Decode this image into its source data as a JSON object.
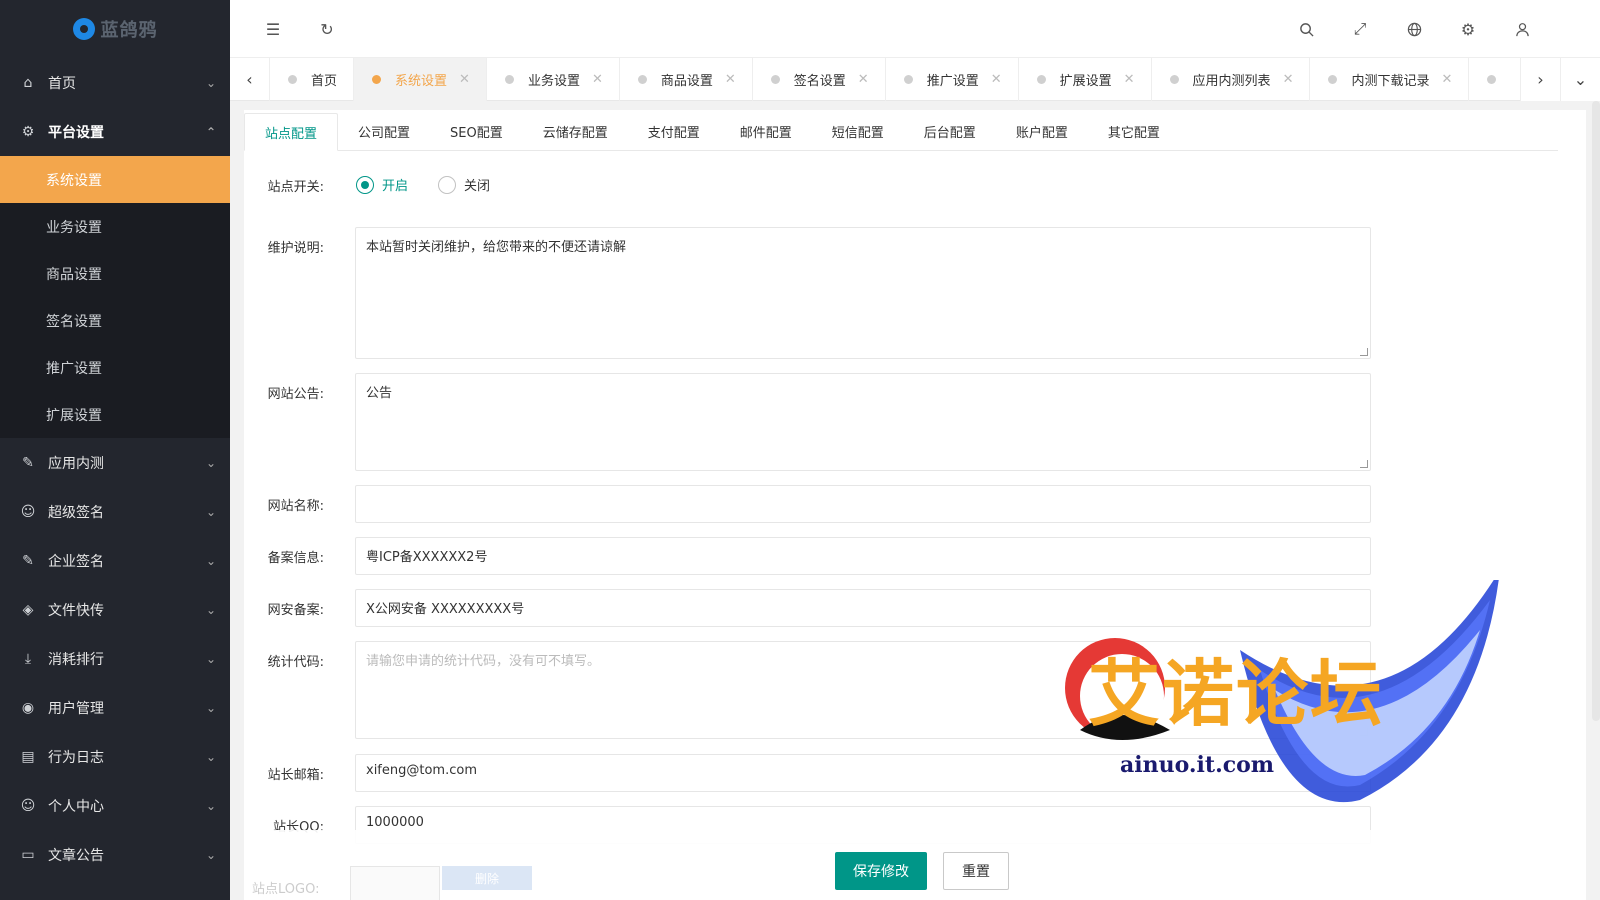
{
  "logo": {
    "text": "蓝鸽鸦"
  },
  "sidebar": {
    "home": "首页",
    "platform": "平台设置",
    "platform_sub": [
      "系统设置",
      "业务设置",
      "商品设置",
      "签名设置",
      "推广设置",
      "扩展设置"
    ],
    "groups": [
      "应用内测",
      "超级签名",
      "企业签名",
      "文件快传",
      "消耗排行",
      "用户管理",
      "行为日志",
      "个人中心",
      "文章公告"
    ]
  },
  "tabs": [
    {
      "label": "首页",
      "closable": false
    },
    {
      "label": "系统设置",
      "closable": true
    },
    {
      "label": "业务设置",
      "closable": true
    },
    {
      "label": "商品设置",
      "closable": true
    },
    {
      "label": "签名设置",
      "closable": true
    },
    {
      "label": "推广设置",
      "closable": true
    },
    {
      "label": "扩展设置",
      "closable": true
    },
    {
      "label": "应用内测列表",
      "closable": true
    },
    {
      "label": "内测下载记录",
      "closable": true
    }
  ],
  "subtabs": [
    "站点配置",
    "公司配置",
    "SEO配置",
    "云储存配置",
    "支付配置",
    "邮件配置",
    "短信配置",
    "后台配置",
    "账户配置",
    "其它配置"
  ],
  "form": {
    "site_switch_label": "站点开关:",
    "radio_on": "开启",
    "radio_off": "关闭",
    "maintenance_label": "维护说明:",
    "maintenance_value": "本站暂时关闭维护，给您带来的不便还请谅解",
    "notice_label": "网站公告:",
    "notice_value": "公告",
    "site_name_label": "网站名称:",
    "icp_label": "备案信息:",
    "icp_value": "粤ICP备XXXXXX2号",
    "police_label": "网安备案:",
    "police_value": "X公网安备 XXXXXXXXX号",
    "stats_label": "统计代码:",
    "stats_placeholder": "请输您申请的统计代码，没有可不填写。",
    "email_label": "站长邮箱:",
    "email_value": "xifeng@tom.com",
    "qq_label": "站长QQ:",
    "qq_value": "1000000",
    "logo_label": "站点LOGO:",
    "delete_button": "删除"
  },
  "actions": {
    "save": "保存修改",
    "reset": "重置"
  },
  "watermark": {
    "title": "艾诺论坛",
    "url": "ainuo.it.com"
  },
  "colors": {
    "sidebar_bg": "#23262e",
    "accent_orange": "#f3a64c",
    "accent_green": "#009688"
  }
}
